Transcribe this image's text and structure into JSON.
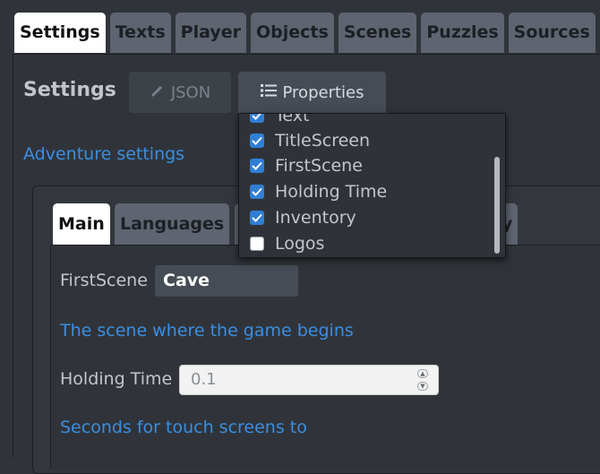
{
  "top_tabs": [
    "Settings",
    "Texts",
    "Player",
    "Objects",
    "Scenes",
    "Puzzles",
    "Sources"
  ],
  "heading": "Settings",
  "json_button": "JSON",
  "properties_button": "Properties",
  "adventure_link": "Adventure settings",
  "inner_tabs": {
    "main": "Main",
    "languages": "Languages",
    "last_fragment": "y"
  },
  "first_scene": {
    "label": "FirstScene",
    "value": "Cave",
    "help": "The scene where the game begins"
  },
  "holding_time": {
    "label": "Holding Time",
    "placeholder": "0.1",
    "help": "Seconds for touch screens to"
  },
  "properties_list": [
    {
      "label": "Text",
      "checked": true
    },
    {
      "label": "TitleScreen",
      "checked": true
    },
    {
      "label": "FirstScene",
      "checked": true
    },
    {
      "label": "Holding Time",
      "checked": true
    },
    {
      "label": "Inventory",
      "checked": true
    },
    {
      "label": "Logos",
      "checked": false
    }
  ],
  "colors": {
    "accent": "#2f7fd6",
    "link": "#3b8ee0",
    "background": "#30343a"
  }
}
